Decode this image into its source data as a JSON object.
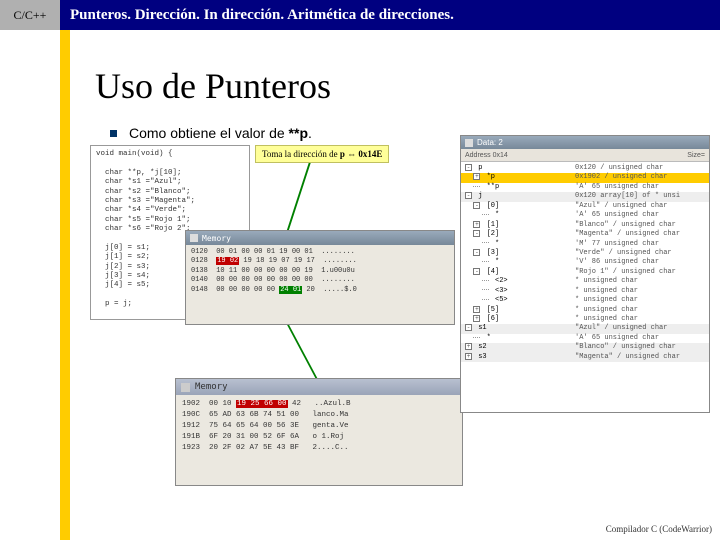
{
  "header": {
    "tag": "C/C++",
    "title": "Punteros. Dirección. In dirección. Aritmética de direcciones."
  },
  "slide_title": "Uso de Punteros",
  "bullet": {
    "prefix": "Como obtiene el valor de ",
    "expr": "**p",
    "suffix": "."
  },
  "callout": {
    "prefix": "Toma la dirección de ",
    "var": "p",
    "arrow": " ⇔ ",
    "addr": "0x14E"
  },
  "code_block": "void main(void) {\n\n  char **p, *j[10];\n  char *s1 =\"Azul\";\n  char *s2 =\"Blanco\";\n  char *s3 =\"Magenta\";\n  char *s4 =\"Verde\";\n  char *s5 =\"Rojo 1\";\n  char *s6 =\"Rojo 2\";\n\n  j[0] = s1;\n  j[1] = s2;\n  j[2] = s3;\n  j[3] = s4;\n  j[4] = s5;\n\n  p = j;\n",
  "memory1": {
    "title": "Memory",
    "rows": [
      {
        "addr": "0120",
        "bytes": "00 01 00 00 01 19 00 01",
        "ascii": "........"
      },
      {
        "addr": "0128",
        "bytes": "19 02 19 18 19 07 19 17",
        "ascii": "........",
        "hl": "red",
        "hl_start": 0,
        "hl_end": 5
      },
      {
        "addr": "0138",
        "bytes": "10 11 00 00 00 00 00 19",
        "ascii": "1.u00u0u"
      },
      {
        "addr": "0140",
        "bytes": "00 00 00 00 00 00 00 00",
        "ascii": "........"
      },
      {
        "addr": "0148",
        "bytes": "00 00 00 00 00 24 01 20",
        "ascii": ".....$.0",
        "hl": "green",
        "hl_start": 15,
        "hl_end": 20
      }
    ]
  },
  "memory2": {
    "title": "Memory",
    "rows": [
      {
        "addr": "1902",
        "bytes": "00 10 19 25 66 00 42",
        "ascii": "..Azul.B",
        "hl": "red",
        "hl_start": 6,
        "hl_end": 17
      },
      {
        "addr": "190C",
        "bytes": "65 AD 63 6B 74 51 00",
        "ascii": "lanco.Ma"
      },
      {
        "addr": "1912",
        "bytes": "75 64 65 64 00 56 3E",
        "ascii": "genta.Ve"
      },
      {
        "addr": "191B",
        "bytes": "6F 20 31 00 52 6F 6A",
        "ascii": "o 1.Roj"
      },
      {
        "addr": "1923",
        "bytes": "20 2F 02 A7 5E 43 BF",
        "ascii": "2....C.."
      }
    ]
  },
  "data_panel": {
    "title": "Data: 2",
    "subhead_left": "Address 0x14",
    "subhead_right": "Size=",
    "rows": [
      {
        "i": 0,
        "box": "-",
        "name": "p",
        "val": "0x120 / unsigned char"
      },
      {
        "i": 1,
        "box": "+",
        "name": "*p",
        "val": "0x1902 / unsigned char",
        "gold": true
      },
      {
        "i": 1,
        "box": "",
        "name": "**p",
        "val": "'A' 65 unsigned char"
      },
      {
        "i": 0,
        "box": "-",
        "name": "j",
        "val": "0x120 array[10] of * unsi",
        "grp": true
      },
      {
        "i": 1,
        "box": "-",
        "name": "[0]",
        "val": "\"Azul\" / unsigned char"
      },
      {
        "i": 2,
        "box": "",
        "name": "*",
        "val": "'A' 65 unsigned char"
      },
      {
        "i": 1,
        "box": "+",
        "name": "[1]",
        "val": "\"Blanco\" / unsigned char"
      },
      {
        "i": 1,
        "box": "-",
        "name": "[2]",
        "val": "\"Magenta\" / unsigned char"
      },
      {
        "i": 2,
        "box": "",
        "name": "*",
        "val": "'M' 77 unsigned char"
      },
      {
        "i": 1,
        "box": "-",
        "name": "[3]",
        "val": "\"Verde\" / unsigned char"
      },
      {
        "i": 2,
        "box": "",
        "name": "*",
        "val": "'V' 86 unsigned char"
      },
      {
        "i": 1,
        "box": "-",
        "name": "[4]",
        "val": "\"Rojo 1\" / unsigned char"
      },
      {
        "i": 2,
        "box": "",
        "name": "<2>",
        "val": "* unsigned char"
      },
      {
        "i": 2,
        "box": "",
        "name": "<3>",
        "val": "* unsigned char"
      },
      {
        "i": 2,
        "box": "",
        "name": "<5>",
        "val": "* unsigned char"
      },
      {
        "i": 1,
        "box": "+",
        "name": "[5]",
        "val": "* unsigned char"
      },
      {
        "i": 1,
        "box": "+",
        "name": "[6]",
        "val": "* unsigned char"
      },
      {
        "i": 0,
        "box": "-",
        "name": "s1",
        "val": "\"Azul\" / unsigned char",
        "grp": true
      },
      {
        "i": 1,
        "box": "",
        "name": "*",
        "val": "'A' 65 unsigned char"
      },
      {
        "i": 0,
        "box": "+",
        "name": "s2",
        "val": "\"Blanco\" / unsigned char",
        "grp": true
      },
      {
        "i": 0,
        "box": "+",
        "name": "s3",
        "val": "\"Magenta\" / unsigned char",
        "grp": true
      }
    ]
  },
  "footer": "Compilador C (CodeWarrior)"
}
